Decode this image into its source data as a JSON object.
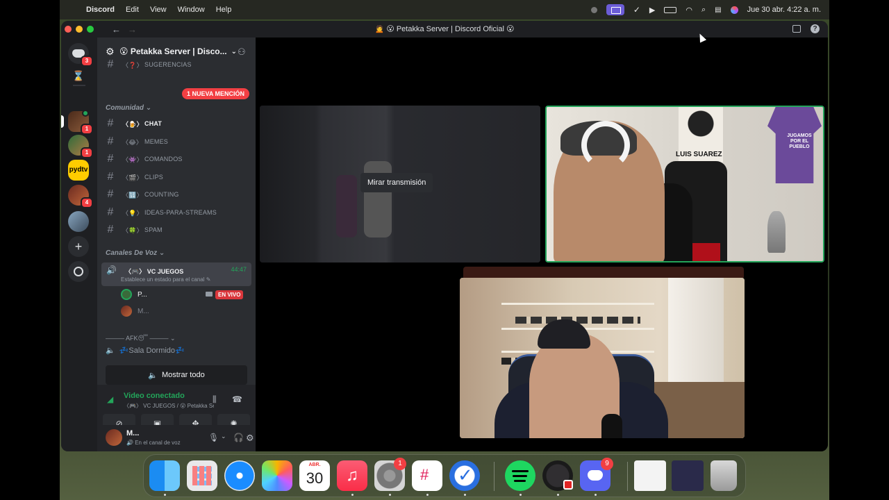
{
  "menubar": {
    "app": "Discord",
    "items": [
      "Edit",
      "View",
      "Window",
      "Help"
    ],
    "clock": "Jue 30 abr.  4:22 a. m."
  },
  "window": {
    "title": "🙍 😮 Petakka Server | Discord Oficial 😮",
    "back": "←",
    "forward": "→"
  },
  "rail": {
    "dm_badge": "3",
    "servers": [
      {
        "badge": "1"
      },
      {
        "badge": "1"
      },
      {
        "label": "pydtv"
      },
      {
        "badge": "4"
      },
      {}
    ],
    "add": "+"
  },
  "server": {
    "name": "😮 Petakka Server | Disco...",
    "mention_pill": "1 NUEVA MENCIÓN",
    "top_channel": "SUGERENCIAS",
    "categories": [
      "Comunidad",
      "Canales De Voz"
    ],
    "channels": [
      {
        "emoji": "〈🍺〉",
        "name": "CHAT"
      },
      {
        "emoji": "〈😂〉",
        "name": "MEMES"
      },
      {
        "emoji": "〈👾〉",
        "name": "COMANDOS"
      },
      {
        "emoji": "〈🎬〉",
        "name": "CLIPS"
      },
      {
        "emoji": "〈🔢〉",
        "name": "COUNTING"
      },
      {
        "emoji": "〈💡〉",
        "name": "IDEAS-PARA-STREAMS"
      },
      {
        "emoji": "〈🍀〉",
        "name": "SPAM"
      }
    ],
    "voice_channel": {
      "emoji": "〈🎮〉",
      "name": "VC JUEGOS",
      "time": "44:47",
      "status": "Establece un estado para el canal ✎",
      "members": [
        {
          "name": "P...",
          "live": "EN VIVO"
        },
        {
          "name": "M..."
        }
      ]
    },
    "afk_category": "——— AFK😴 ———",
    "sleep_channel": "💤Sala Dormido💤",
    "show_all": "Mostrar todo"
  },
  "voice_connection": {
    "title": "Video conectado",
    "subtitle": "〈🎮〉 VC JUEGOS / 😮 Petakka Server | Di..."
  },
  "user": {
    "name": "M...",
    "status": "En el canal de voz"
  },
  "stage": {
    "watch_stream": "Mirar transmisión",
    "poster_text": "LUIS SUAREZ",
    "jersey_text": "JUGAMOS POR EL PUEBLO"
  },
  "dock": {
    "calendar_month": "ABR.",
    "calendar_day": "30",
    "settings_badge": "1",
    "discord_badge": "9"
  },
  "colors": {
    "discord_bg": "#1e1f22",
    "sidebar_bg": "#2b2d31",
    "accent_green": "#23a55a",
    "mention_red": "#f23f43",
    "blurple": "#5865f2"
  }
}
